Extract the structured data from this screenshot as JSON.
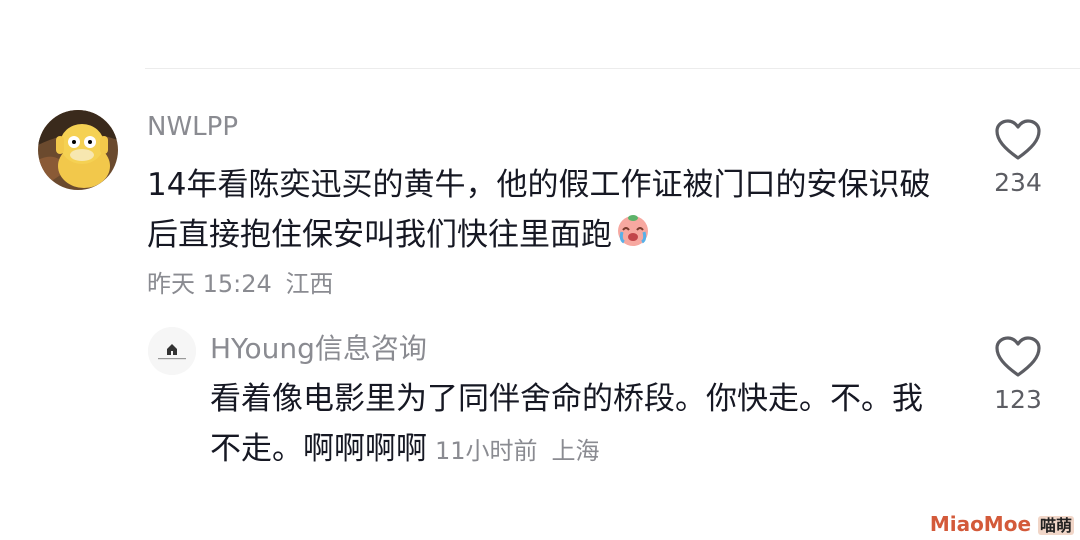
{
  "comments": [
    {
      "username": "NWLPP",
      "text": "14年看陈奕迅买的黄牛，他的假工作证被门口的安保识破后直接抱住保安叫我们快往里面跑",
      "time": "昨天 15:24",
      "location": "江西",
      "likes": "234",
      "avatar_icon": "duck-avatar"
    },
    {
      "username": "HYoung信息咨询",
      "text": "看着像电影里为了同伴舍命的桥段。你快走。不。我不走。啊啊啊啊",
      "time": "11小时前",
      "location": "上海",
      "likes": "123",
      "avatar_icon": "house-logo-avatar"
    }
  ],
  "watermark": {
    "latin": "MiaoMoe",
    "cn": "喵萌"
  },
  "colors": {
    "text": "#161823",
    "secondary": "#8a8b91",
    "divider": "#ececec"
  }
}
